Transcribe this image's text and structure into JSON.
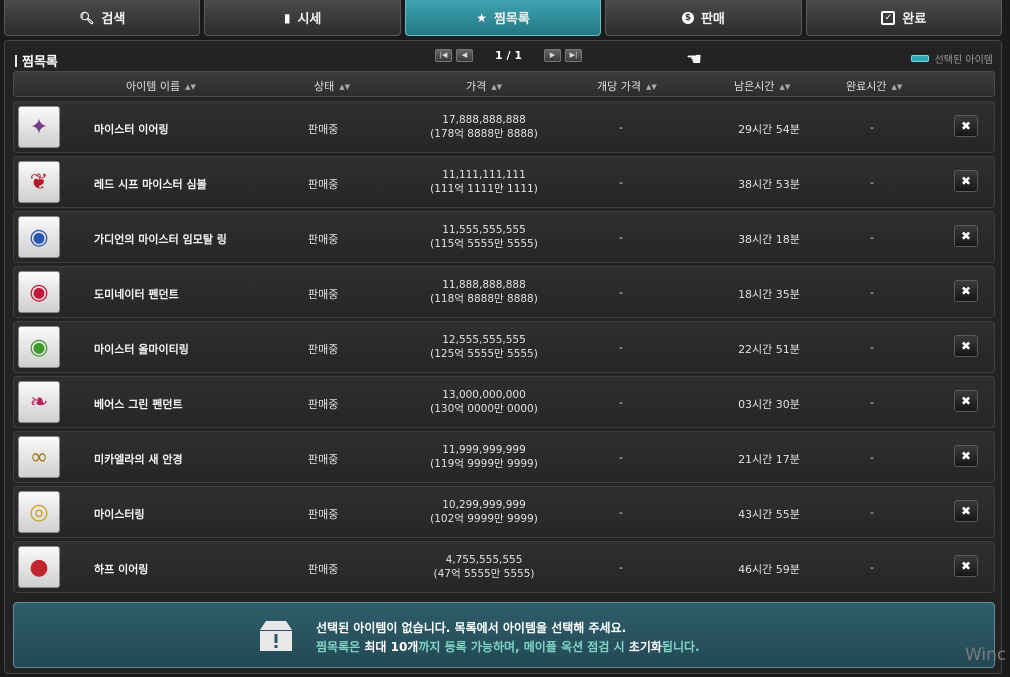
{
  "tabs": [
    {
      "label": "검색",
      "icon": "search-icon",
      "active": false
    },
    {
      "label": "시세",
      "icon": "chart-icon",
      "active": false
    },
    {
      "label": "찜목록",
      "icon": "star-icon",
      "active": true
    },
    {
      "label": "판매",
      "icon": "coin-icon",
      "active": false
    },
    {
      "label": "완료",
      "icon": "checkbox-icon",
      "active": false
    }
  ],
  "panel": {
    "title": "찜목록",
    "pager": {
      "text": "1 / 1"
    },
    "legend": "선택된 아이템"
  },
  "columns": {
    "name": "아이템 이름",
    "status": "상태",
    "price": "가격",
    "unit_price": "개당 가격",
    "remaining": "남은시간",
    "completed": "완료시간"
  },
  "rows": [
    {
      "name": "마이스터 이어링",
      "status": "판매중",
      "price": "17,888,888,888",
      "price_kr": "(178억 8888만 8888)",
      "unit": "-",
      "remaining": "29시간 54분",
      "completed": "-",
      "icon": "earring-icon",
      "icon_glyph": "✦",
      "icon_color": "#7a3a8c"
    },
    {
      "name": "레드 시프 마이스터 심볼",
      "status": "판매중",
      "price": "11,111,111,111",
      "price_kr": "(111억 1111만 1111)",
      "unit": "-",
      "remaining": "38시간 53분",
      "completed": "-",
      "icon": "symbol-icon",
      "icon_glyph": "❦",
      "icon_color": "#b21c2a"
    },
    {
      "name": "가디언의 마이스터 임모탈 링",
      "status": "판매중",
      "price": "11,555,555,555",
      "price_kr": "(115억 5555만 5555)",
      "unit": "-",
      "remaining": "38시간 18분",
      "completed": "-",
      "icon": "ring-icon",
      "icon_glyph": "◉",
      "icon_color": "#2a55b0"
    },
    {
      "name": "도미네이터 펜던트",
      "status": "판매중",
      "price": "11,888,888,888",
      "price_kr": "(118억 8888만 8888)",
      "unit": "-",
      "remaining": "18시간 35분",
      "completed": "-",
      "icon": "pendant-icon",
      "icon_glyph": "◉",
      "icon_color": "#c01a3a"
    },
    {
      "name": "마이스터 올마이티링",
      "status": "판매중",
      "price": "12,555,555,555",
      "price_kr": "(125억 5555만 5555)",
      "unit": "-",
      "remaining": "22시간 51분",
      "completed": "-",
      "icon": "ring-icon",
      "icon_glyph": "◉",
      "icon_color": "#3f9a2c"
    },
    {
      "name": "베어스 그린 펜던트",
      "status": "판매중",
      "price": "13,000,000,000",
      "price_kr": "(130억 0000만 0000)",
      "unit": "-",
      "remaining": "03시간 30분",
      "completed": "-",
      "icon": "pendant-icon",
      "icon_glyph": "❧",
      "icon_color": "#b5245e"
    },
    {
      "name": "미카엘라의 새 안경",
      "status": "판매중",
      "price": "11,999,999,999",
      "price_kr": "(119억 9999만 9999)",
      "unit": "-",
      "remaining": "21시간 17분",
      "completed": "-",
      "icon": "glasses-icon",
      "icon_glyph": "∞",
      "icon_color": "#a07a1a"
    },
    {
      "name": "마이스터링",
      "status": "판매중",
      "price": "10,299,999,999",
      "price_kr": "(102억 9999만 9999)",
      "unit": "-",
      "remaining": "43시간 55분",
      "completed": "-",
      "icon": "ring-icon",
      "icon_glyph": "◎",
      "icon_color": "#c9a020"
    },
    {
      "name": "하프 이어링",
      "status": "판매중",
      "price": "4,755,555,555",
      "price_kr": "(47억 5555만 5555)",
      "unit": "-",
      "remaining": "46시간 59분",
      "completed": "-",
      "icon": "earring-icon",
      "icon_glyph": "●",
      "icon_color": "#c0262e"
    }
  ],
  "info": {
    "line1": "선택된 아이템이 없습니다. 목록에서 아이템을 선택해 주세요.",
    "line2_a": "찜목록은 ",
    "line2_b": "최대 10개",
    "line2_c": "까지 등록 가능하며, 메이플 옥션 점검 시 ",
    "line2_d": "초기화",
    "line2_e": "됩니다."
  },
  "watermark": "Winc"
}
